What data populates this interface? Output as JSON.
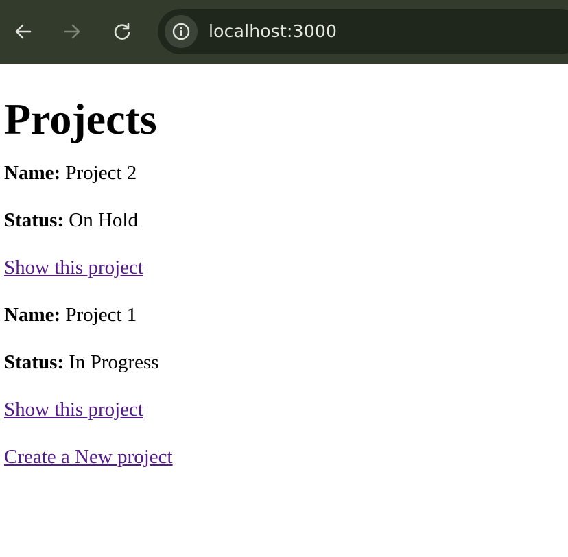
{
  "browser": {
    "url": "localhost:3000",
    "back_icon": "arrow-left-icon",
    "forward_icon": "arrow-right-icon",
    "reload_icon": "reload-icon",
    "site_info_icon": "info-icon",
    "toolbar_color": "#323b2c"
  },
  "page": {
    "title": "Projects",
    "projects": [
      {
        "name_label": "Name:",
        "name": "Project 2",
        "status_label": "Status:",
        "status": "On Hold",
        "link_label": "Show this project"
      },
      {
        "name_label": "Name:",
        "name": "Project 1",
        "status_label": "Status:",
        "status": "In Progress",
        "link_label": "Show this project"
      }
    ],
    "new_link_label": "Create a New project",
    "link_color": "#551a8b"
  }
}
